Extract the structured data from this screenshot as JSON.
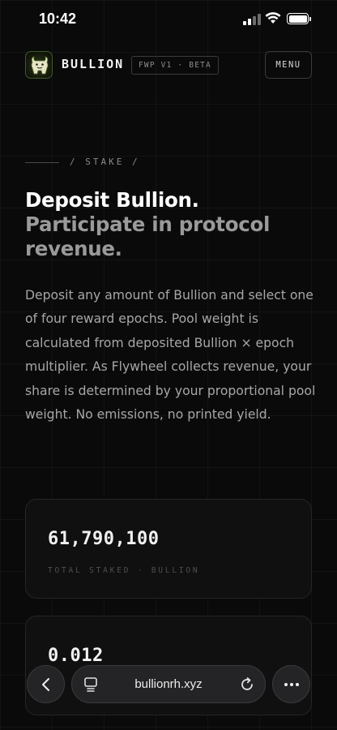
{
  "status_bar": {
    "time": "10:42"
  },
  "header": {
    "brand": "BULLION",
    "badge": "FWP V1 · BETA",
    "menu_label": "MENU"
  },
  "section": {
    "label": "/ STAKE /"
  },
  "hero": {
    "headline_primary": "Deposit Bullion.",
    "headline_secondary": "Participate in protocol revenue.",
    "body": "Deposit any amount of Bullion and select one of four reward epochs. Pool weight is calculated from deposited Bullion × epoch multiplier. As Flywheel collects revenue, your share is determined by your proportional pool weight. No emissions, no printed yield."
  },
  "stats": [
    {
      "value": "61,790,100",
      "label": "TOTAL STAKED · BULLION"
    },
    {
      "value": "0.012",
      "label": ""
    }
  ],
  "browser": {
    "url": "bullionrh.xyz"
  },
  "icons": {
    "back": "chevron-left-icon",
    "reader": "reader-mode-icon",
    "reload": "reload-icon",
    "more": "more-dots-icon"
  },
  "colors": {
    "background": "#0a0a0b",
    "card": "#101011",
    "text_primary": "#ffffff",
    "text_secondary": "#9a9a9a"
  }
}
